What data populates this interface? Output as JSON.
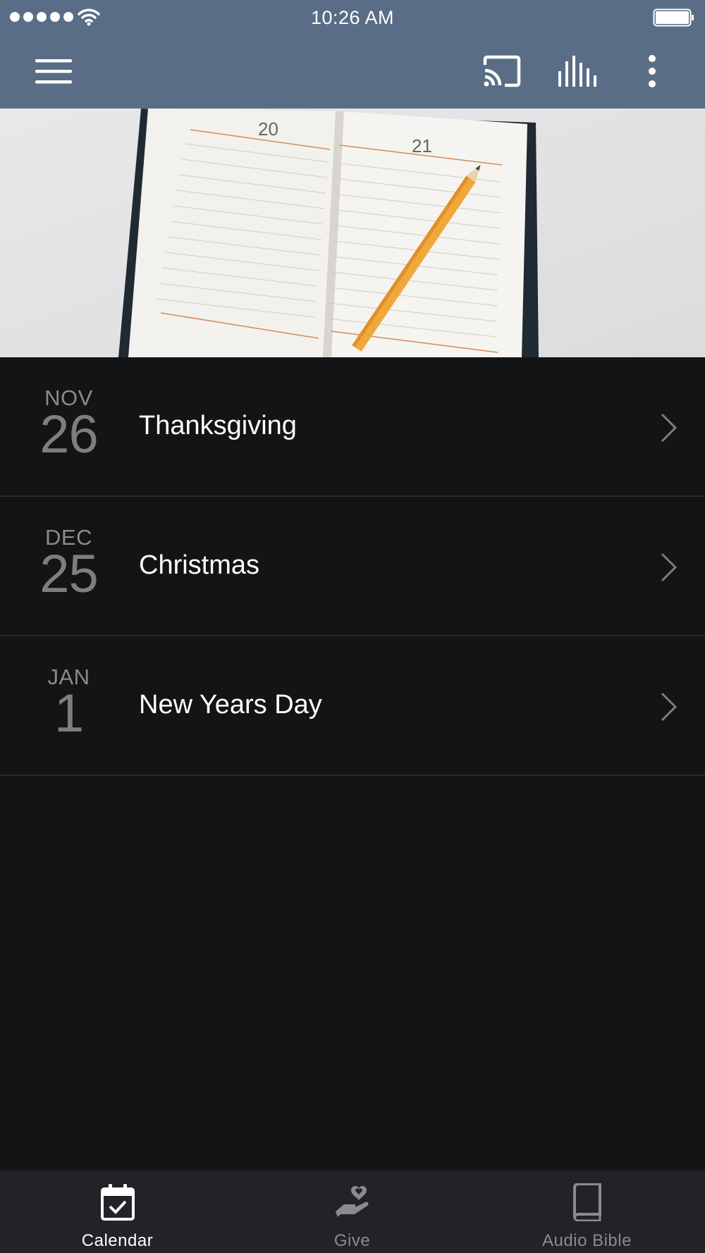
{
  "status_bar": {
    "time": "10:26 AM"
  },
  "colors": {
    "header": "#5a6d86",
    "background": "#131416",
    "tab_bar": "#222326",
    "active_tab": "#ffffff",
    "inactive_tab": "#8a8b8e"
  },
  "app_bar": {
    "icons": [
      "menu-icon",
      "cast-icon",
      "equalizer-icon",
      "more-vertical-icon"
    ]
  },
  "hero": {
    "image": "open-planner-with-pencil"
  },
  "events": [
    {
      "month": "NOV",
      "day": "26",
      "title": "Thanksgiving"
    },
    {
      "month": "DEC",
      "day": "25",
      "title": "Christmas"
    },
    {
      "month": "JAN",
      "day": "1",
      "title": "New Years Day"
    }
  ],
  "tabs": [
    {
      "label": "Calendar",
      "icon": "calendar-check-icon",
      "active": true
    },
    {
      "label": "Give",
      "icon": "heart-hand-icon",
      "active": false
    },
    {
      "label": "Audio Bible",
      "icon": "book-icon",
      "active": false
    }
  ]
}
